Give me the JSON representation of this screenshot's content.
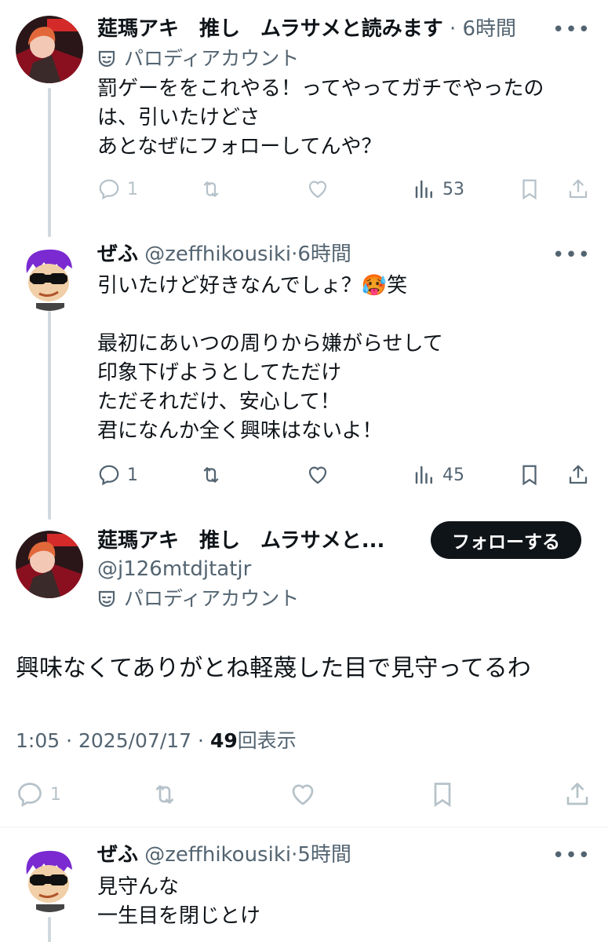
{
  "tweets": [
    {
      "author": "莚瑪アキ　推し　ムラサメと読みます",
      "time": "6時間",
      "badge": "パロディアカウント",
      "lines": [
        "罰ゲーををこれやる！ってやってガチでやったの",
        "は、引いたけどさ",
        "あとなぜにフォローしてんや？"
      ],
      "replies": "1",
      "views": "53"
    },
    {
      "author": "ぜふ",
      "handle": "@zeffhikousiki",
      "time": "6時間",
      "line1": "引いたけど好きなんでしょ？",
      "line1_emoji": "🥵",
      "line1_tail": "笑",
      "lines": [
        "最初にあいつの周りから嫌がらせして",
        "印象下げようとしてただけ",
        "ただそれだけ、安心して！",
        "君になんか全く興味はないよ！"
      ],
      "replies": "1",
      "views": "45"
    }
  ],
  "main": {
    "author": "莚瑪アキ　推し　ムラサメと...",
    "handle": "@j126mtdjtatjr",
    "badge": "パロディアカウント",
    "follow": "フォローする",
    "text": "興味なくてありがとね軽蔑した目で見守ってるわ",
    "time": "1:05",
    "date": "2025/07/17",
    "views": "49",
    "views_label": "回表示",
    "replies": "1"
  },
  "reply": {
    "author": "ぜふ",
    "handle": "@zeffhikousiki",
    "time": "5時間",
    "lines": [
      "見守んな",
      "一生目を閉じとけ"
    ]
  },
  "colors": {
    "text": "#0f1419",
    "secondary": "#536471",
    "thread": "#cfd9de",
    "button": "#0f1419"
  },
  "icons": [
    "more-icon",
    "parody-mask-icon",
    "reply-icon",
    "retweet-icon",
    "like-icon",
    "views-icon",
    "bookmark-icon",
    "share-icon"
  ]
}
